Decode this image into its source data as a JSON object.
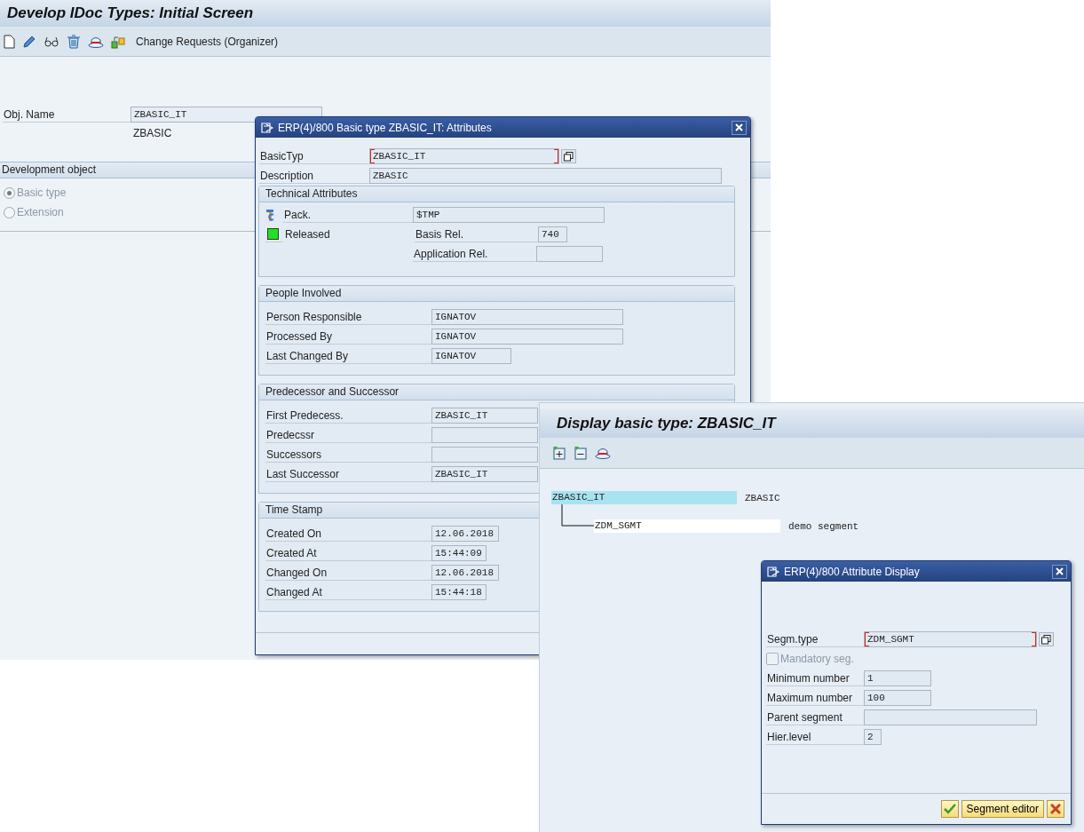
{
  "main_window": {
    "title": "Develop IDoc Types: Initial Screen",
    "toolbar": {
      "action": "Change Requests (Organizer)"
    },
    "obj_name": {
      "label": "Obj. Name",
      "value": "ZBASIC_IT",
      "description": "ZBASIC"
    },
    "development_object": {
      "title": "Development object",
      "options": [
        {
          "label": "Basic type",
          "selected": true,
          "disabled": true
        },
        {
          "label": "Extension",
          "selected": false,
          "disabled": true
        }
      ]
    }
  },
  "attributes_dialog": {
    "title": "ERP(4)/800 Basic type ZBASIC_IT: Attributes",
    "basic_type": {
      "label": "BasicTyp",
      "value": "ZBASIC_IT",
      "focused": true
    },
    "description": {
      "label": "Description",
      "value": "ZBASIC"
    },
    "technical_attributes": {
      "title": "Technical Attributes",
      "package": {
        "label": "Pack.",
        "value": "$TMP"
      },
      "released": {
        "label": "Released",
        "on": true
      },
      "basis_rel": {
        "label": "Basis Rel.",
        "value": "740"
      },
      "application_rel": {
        "label": "Application Rel."
      }
    },
    "sections": [
      {
        "title": "People Involved",
        "fields": [
          {
            "label": "Person Responsible",
            "value": "IGNATOV",
            "kind": "long"
          },
          {
            "label": "Processed By",
            "value": "IGNATOV",
            "kind": "long"
          },
          {
            "label": "Last Changed By",
            "value": "IGNATOV",
            "kind": "short"
          }
        ]
      },
      {
        "title": "Predecessor and Successor",
        "fields": [
          {
            "label": "First Predecess.",
            "value": "ZBASIC_IT",
            "kind": "cut"
          },
          {
            "label": "Predecssr",
            "kind": "cut"
          },
          {
            "label": "Successors",
            "kind": "cut"
          },
          {
            "label": "Last Successor",
            "value": "ZBASIC_IT",
            "kind": "cut"
          }
        ]
      },
      {
        "title": "Time Stamp",
        "fields": [
          {
            "label": "Created On",
            "value": "12.06.2018",
            "kind": "date"
          },
          {
            "label": "Created At",
            "value": "15:44:09",
            "kind": "time"
          },
          {
            "label": "Changed On",
            "value": "12.06.2018",
            "kind": "date"
          },
          {
            "label": "Changed At",
            "value": "15:44:18",
            "kind": "time"
          }
        ]
      }
    ]
  },
  "display_window": {
    "title": "Display basic type: ZBASIC_IT",
    "tree": [
      {
        "name": "ZBASIC_IT",
        "description": "ZBASIC",
        "selected": true,
        "children": [
          {
            "name": "ZDM_SGMT",
            "description": "demo segment",
            "selected": false
          }
        ]
      }
    ]
  },
  "segment_dialog": {
    "title": "ERP(4)/800 Attribute Display",
    "segment_type": {
      "label": "Segm.type",
      "value": "ZDM_SGMT",
      "focused": true
    },
    "mandatory": {
      "label": "Mandatory seg.",
      "checked": false,
      "disabled": true
    },
    "fields": [
      {
        "label": "Minimum number",
        "value": "1",
        "kind": "medium"
      },
      {
        "label": "Maximum number",
        "value": "100",
        "kind": "medium"
      },
      {
        "label": "Parent segment",
        "kind": "long"
      },
      {
        "label": "Hier.level",
        "value": "2",
        "kind": "tiny"
      }
    ],
    "buttons": {
      "segment_editor": "Segment editor"
    }
  }
}
